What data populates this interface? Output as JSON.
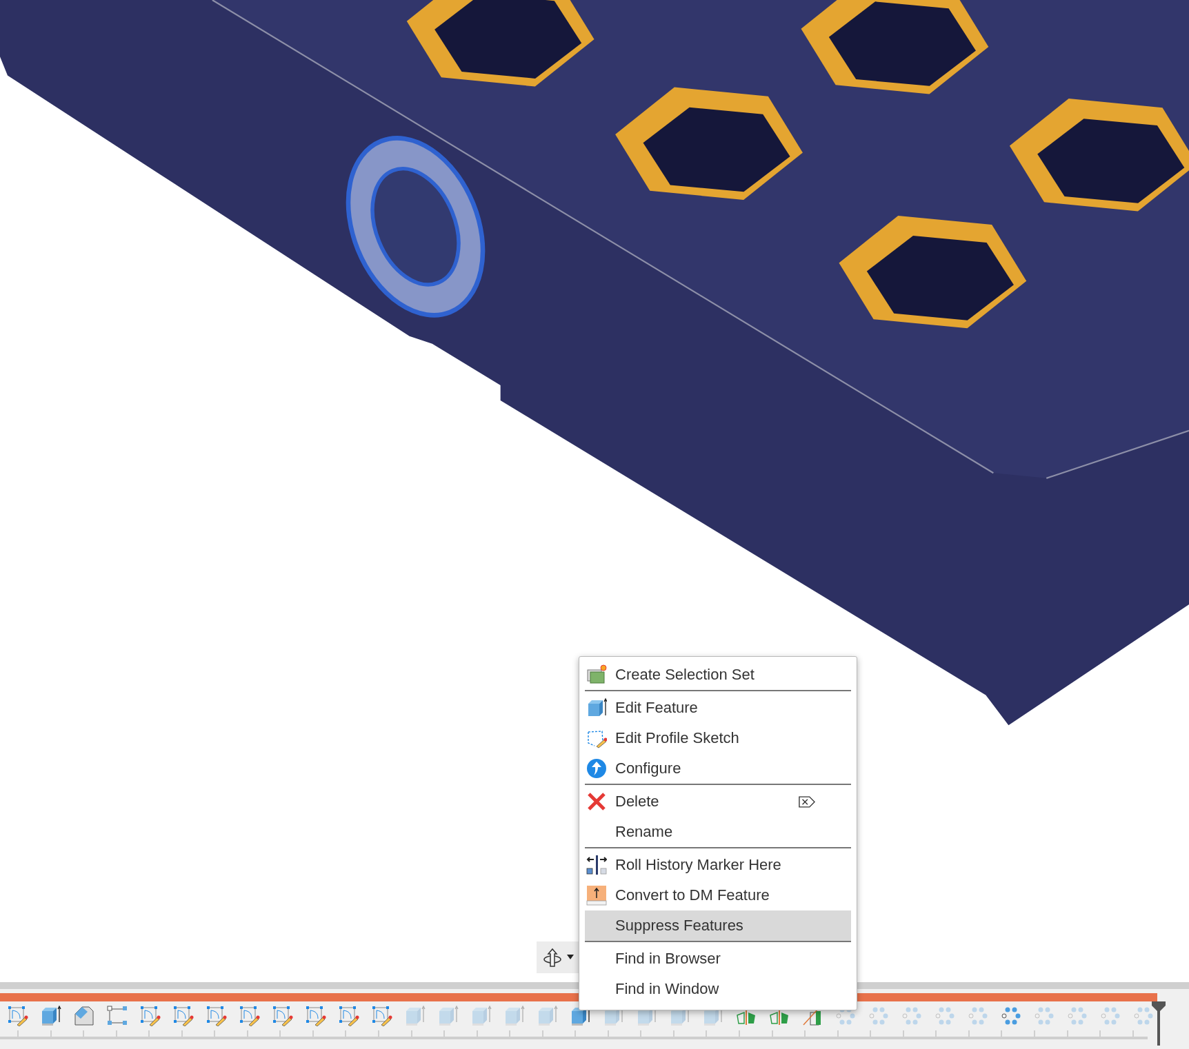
{
  "context_menu": {
    "items": [
      {
        "label": "Create Selection Set",
        "kind": "selection-set",
        "highlighted": false,
        "separator_after": true,
        "shortcut_icon": false
      },
      {
        "label": "Edit Feature",
        "kind": "extrude",
        "highlighted": false,
        "separator_after": false,
        "shortcut_icon": false
      },
      {
        "label": "Edit Profile Sketch",
        "kind": "sketch",
        "highlighted": false,
        "separator_after": false,
        "shortcut_icon": false
      },
      {
        "label": "Configure",
        "kind": "configure",
        "highlighted": false,
        "separator_after": true,
        "shortcut_icon": false
      },
      {
        "label": "Delete",
        "kind": "delete",
        "highlighted": false,
        "separator_after": false,
        "shortcut_icon": true
      },
      {
        "label": "Rename",
        "kind": "plain",
        "highlighted": false,
        "separator_after": true,
        "shortcut_icon": false
      },
      {
        "label": "Roll History Marker Here",
        "kind": "roll",
        "highlighted": false,
        "separator_after": false,
        "shortcut_icon": false
      },
      {
        "label": "Convert to DM Feature",
        "kind": "convert",
        "highlighted": false,
        "separator_after": false,
        "shortcut_icon": false
      },
      {
        "label": "Suppress Features",
        "kind": "plain",
        "highlighted": true,
        "separator_after": true,
        "shortcut_icon": false
      },
      {
        "label": "Find in Browser",
        "kind": "plain",
        "highlighted": false,
        "separator_after": false,
        "shortcut_icon": false
      },
      {
        "label": "Find in Window",
        "kind": "plain",
        "highlighted": false,
        "separator_after": false,
        "shortcut_icon": false
      }
    ]
  },
  "timeline": {
    "items": [
      {
        "kind": "sketch",
        "dimmed": false
      },
      {
        "kind": "extrude",
        "dimmed": false
      },
      {
        "kind": "chamfer",
        "dimmed": false
      },
      {
        "kind": "constraint",
        "dimmed": false
      },
      {
        "kind": "sketch",
        "dimmed": false
      },
      {
        "kind": "sketch",
        "dimmed": false
      },
      {
        "kind": "sketch",
        "dimmed": false
      },
      {
        "kind": "sketch",
        "dimmed": false
      },
      {
        "kind": "sketch",
        "dimmed": false
      },
      {
        "kind": "sketch",
        "dimmed": false
      },
      {
        "kind": "sketch",
        "dimmed": false
      },
      {
        "kind": "sketch",
        "dimmed": false
      },
      {
        "kind": "extrude",
        "dimmed": true
      },
      {
        "kind": "extrude",
        "dimmed": true
      },
      {
        "kind": "extrude",
        "dimmed": true
      },
      {
        "kind": "extrude",
        "dimmed": true
      },
      {
        "kind": "extrude",
        "dimmed": true
      },
      {
        "kind": "extrude",
        "dimmed": false
      },
      {
        "kind": "extrude",
        "dimmed": true
      },
      {
        "kind": "extrude",
        "dimmed": true
      },
      {
        "kind": "extrude",
        "dimmed": true
      },
      {
        "kind": "extrude",
        "dimmed": true
      },
      {
        "kind": "mirror",
        "dimmed": false
      },
      {
        "kind": "mirror",
        "dimmed": false
      },
      {
        "kind": "split",
        "dimmed": false
      },
      {
        "kind": "pattern",
        "dimmed": true
      },
      {
        "kind": "pattern",
        "dimmed": true
      },
      {
        "kind": "pattern",
        "dimmed": true
      },
      {
        "kind": "pattern",
        "dimmed": true
      },
      {
        "kind": "pattern",
        "dimmed": true
      },
      {
        "kind": "pattern",
        "dimmed": false
      },
      {
        "kind": "pattern",
        "dimmed": true
      },
      {
        "kind": "pattern",
        "dimmed": true
      },
      {
        "kind": "pattern",
        "dimmed": true
      },
      {
        "kind": "pattern",
        "dimmed": true
      }
    ]
  }
}
